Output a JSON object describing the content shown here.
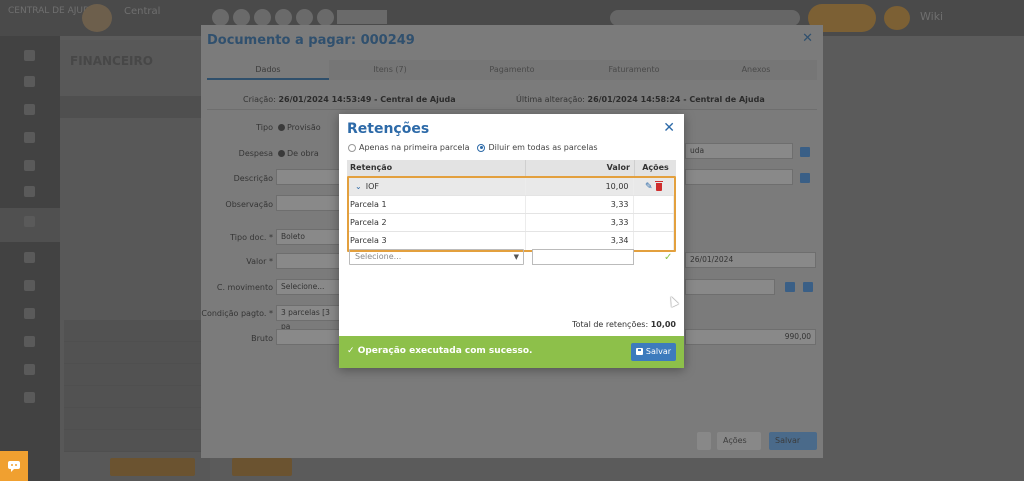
{
  "app": {
    "brand_text": "CENTRAL DE AJUDA",
    "logo_text": "Central",
    "user_label": "Wiki"
  },
  "bg_panel": {
    "title": "FINANCEIRO"
  },
  "document_modal": {
    "title": "Documento a pagar: 000249",
    "tabs": [
      "Dados",
      "Itens (7)",
      "Pagamento",
      "Faturamento",
      "Anexos"
    ],
    "created_label": "Criação:",
    "created_value": "26/01/2024 14:53:49 - Central de Ajuda",
    "updated_label": "Última alteração:",
    "updated_value": "26/01/2024 14:58:24 - Central de Ajuda",
    "fields": {
      "tipo_label": "Tipo",
      "tipo_option": "Provisão",
      "despesa_label": "Despesa",
      "despesa_option": "De obra",
      "descricao_label": "Descrição",
      "observacao_label": "Observação",
      "tipo_doc_label": "Tipo doc. *",
      "tipo_doc_value": "Boleto",
      "valor_label": "Valor *",
      "c_movimento_label": "C. movimento",
      "c_movimento_value": "Selecione...",
      "condicao_label": "Condição pagto. *",
      "condicao_value": "3 parcelas [3 pa",
      "bruto_label": "Bruto",
      "date_value": "26/01/2024",
      "bruto_value": "990,00",
      "right_select_value": "uda"
    },
    "footer": {
      "acoes_label": "Ações",
      "save_label": "Salvar"
    }
  },
  "retencoes": {
    "title": "Retenções",
    "option_first": "Apenas na primeira parcela",
    "option_all": "Diluir em todas as parcelas",
    "selected_option": "all",
    "headers": {
      "retencao": "Retenção",
      "valor": "Valor",
      "acoes": "Ações"
    },
    "group": {
      "name": "IOF",
      "value": "10,00",
      "rows": [
        {
          "label": "Parcela 1",
          "value": "3,33"
        },
        {
          "label": "Parcela 2",
          "value": "3,33"
        },
        {
          "label": "Parcela 3",
          "value": "3,34"
        }
      ]
    },
    "new_row": {
      "select_placeholder": "Selecione..."
    },
    "total_label": "Total de retenções:",
    "total_value": "10,00",
    "success_message": "Operação executada com sucesso.",
    "save_label": "Salvar"
  },
  "colors": {
    "accent": "#2d6aa8",
    "success": "#8dc04a",
    "highlight": "#e3a03e",
    "danger": "#cf2e2e"
  }
}
